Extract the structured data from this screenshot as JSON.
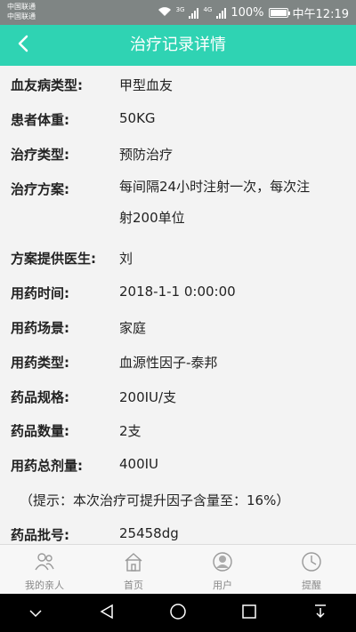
{
  "status_bar": {
    "carrier_1": "中国联通",
    "carrier_2": "中国联通",
    "network_1": "3G",
    "network_2": "4G",
    "battery": "100%",
    "battery_level": 1.0,
    "time": "中午12:19"
  },
  "header": {
    "title": "治疗记录详情",
    "back_icon": "chevron-left-icon"
  },
  "record": {
    "fields": [
      {
        "label": "血友病类型:",
        "value": "甲型血友"
      },
      {
        "label": "患者体重:",
        "value": "50KG"
      },
      {
        "label": "治疗类型:",
        "value": "预防治疗"
      },
      {
        "label": "治疗方案:",
        "value": "每间隔24小时注射一次，每次注射200单位"
      },
      {
        "label": "方案提供医生:",
        "value": "刘"
      },
      {
        "label": "用药时间:",
        "value": "2018-1-1 0:00:00"
      },
      {
        "label": "用药场景:",
        "value": "家庭"
      },
      {
        "label": "用药类型:",
        "value": "血源性因子-泰邦"
      },
      {
        "label": "药品规格:",
        "value": "200IU/支"
      },
      {
        "label": "药品数量:",
        "value": "2支"
      },
      {
        "label": "用药总剂量:",
        "value": "400IU"
      },
      {
        "label": "药品批号:",
        "value": "25458dg"
      }
    ],
    "tip": "（提示：本次治疗可提升因子含量至：16%）"
  },
  "tabs": [
    {
      "label": "我的亲人",
      "icon": "family-icon"
    },
    {
      "label": "首页",
      "icon": "home-icon"
    },
    {
      "label": "用户",
      "icon": "user-icon"
    },
    {
      "label": "提醒",
      "icon": "clock-icon"
    }
  ],
  "nav": {
    "icons": [
      "collapse-icon",
      "back-triangle-icon",
      "home-circle-icon",
      "recents-square-icon",
      "notification-pull-icon"
    ]
  }
}
